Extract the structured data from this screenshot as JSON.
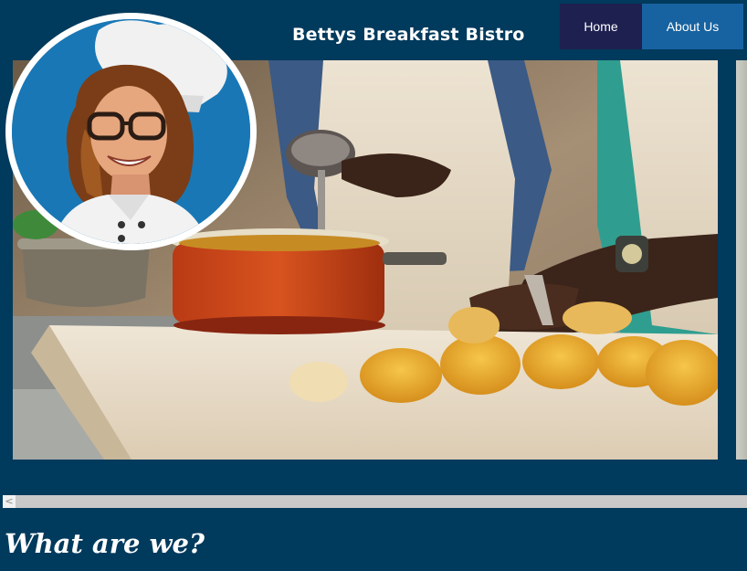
{
  "header": {
    "site_title": "Bettys Breakfast Bistro"
  },
  "nav": {
    "items": [
      {
        "label": "Home"
      },
      {
        "label": "About Us"
      }
    ]
  },
  "scrollbar": {
    "left_arrow": "<"
  },
  "main": {
    "heading": "What are we?"
  },
  "colors": {
    "background": "#003a5c",
    "nav_home": "#1e2050",
    "nav_about": "#1762a0",
    "avatar_bg": "#1a77b5"
  },
  "icons": {
    "scroll_left": "chevron-left-icon"
  }
}
